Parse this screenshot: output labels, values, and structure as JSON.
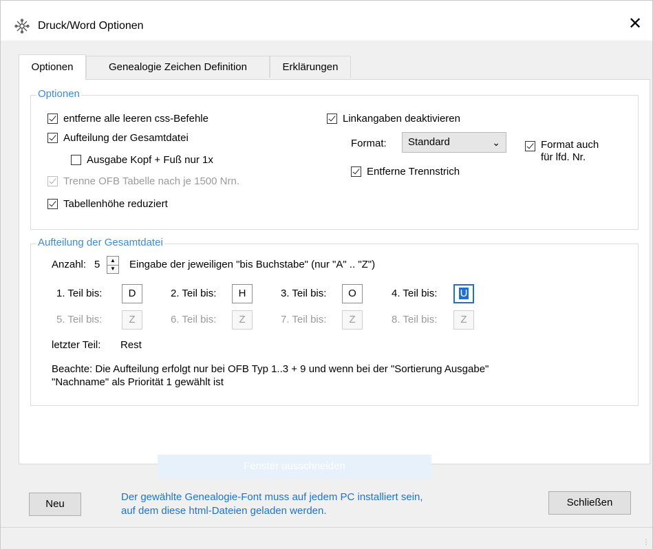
{
  "window": {
    "title": "Druck/Word Optionen",
    "app_icon": "genealogy-tree-icon",
    "close_glyph": "✕"
  },
  "tabs": [
    {
      "label": "Optionen",
      "active": true
    },
    {
      "label": "Genealogie Zeichen Definition",
      "active": false
    },
    {
      "label": "Erklärungen",
      "active": false
    }
  ],
  "options_group": {
    "title": "Optionen",
    "remove_css": {
      "label": "entferne alle leeren css-Befehle",
      "checked": true
    },
    "split_file": {
      "label": "Aufteilung der Gesamtdatei",
      "checked": true
    },
    "header_footer_once": {
      "label": "Ausgabe Kopf + Fuß nur 1x",
      "checked": false
    },
    "split_table": {
      "label": "Trenne OFB Tabelle nach je 1500 Nrn.",
      "checked": true,
      "disabled": true
    },
    "reduce_table_height": {
      "label": "Tabellenhöhe reduziert",
      "checked": true
    },
    "disable_links": {
      "label": "Linkangaben deaktivieren",
      "checked": true
    },
    "format_label": "Format:",
    "format_value": "Standard",
    "format_also": {
      "label_line1": "Format auch",
      "label_line2": "für lfd. Nr.",
      "checked": true
    },
    "remove_hyphen": {
      "label": "Entferne Trennstrich",
      "checked": true
    }
  },
  "split_group": {
    "title": "Aufteilung der Gesamtdatei",
    "count_label": "Anzahl:",
    "count_value": "5",
    "hint": "Eingabe der jeweiligen \"bis Buchstabe\" (nur \"A\" .. \"Z\")",
    "parts": [
      {
        "label": "1. Teil bis:",
        "value": "D",
        "enabled": true
      },
      {
        "label": "2. Teil bis:",
        "value": "H",
        "enabled": true
      },
      {
        "label": "3. Teil bis:",
        "value": "O",
        "enabled": true
      },
      {
        "label": "4. Teil bis:",
        "value": "U",
        "enabled": true,
        "focused": true
      },
      {
        "label": "5. Teil bis:",
        "value": "Z",
        "enabled": false
      },
      {
        "label": "6. Teil bis:",
        "value": "Z",
        "enabled": false
      },
      {
        "label": "7. Teil bis:",
        "value": "Z",
        "enabled": false
      },
      {
        "label": "8. Teil bis:",
        "value": "Z",
        "enabled": false
      }
    ],
    "last_part_label": "letzter Teil:",
    "last_part_value": "Rest",
    "note_line1": "Beachte: Die Aufteilung erfolgt nur bei OFB Typ 1..3 + 9 und wenn bei der \"Sortierung Ausgabe\"",
    "note_line2": "\"Nachname\" als Priorität 1 gewählt ist"
  },
  "ghost_button": "Fenster ausschneiden",
  "footer": {
    "new_button": "Neu",
    "close_button": "Schließen",
    "note_line1": "Der gewählte Genealogie-Font muss auf jedem PC installiert sein,",
    "note_line2": "auf dem diese html-Dateien geladen werden."
  },
  "colors": {
    "accent": "#3c8ad6",
    "link_text": "#1f73c9",
    "focus": "#1e6fd0"
  }
}
